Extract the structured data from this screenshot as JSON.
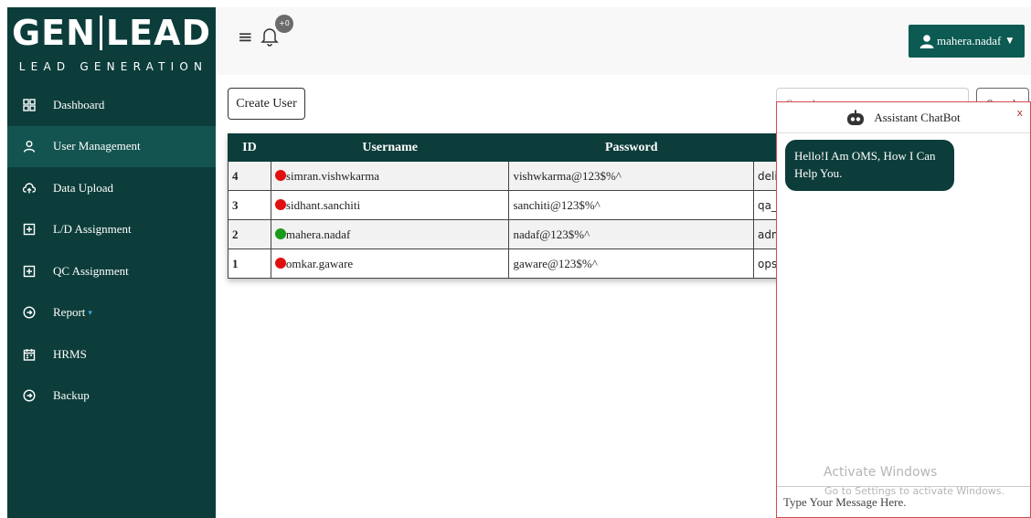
{
  "brand": {
    "name_left": "GEN",
    "name_right": "LEAD",
    "tagline": "LEAD GENERATION"
  },
  "sidebar": {
    "items": [
      {
        "label": "Dashboard",
        "icon": "grid-icon"
      },
      {
        "label": "User Management",
        "icon": "user-icon",
        "active": true
      },
      {
        "label": "Data Upload",
        "icon": "cloud-upload-icon"
      },
      {
        "label": "L/D Assignment",
        "icon": "plus-square-icon"
      },
      {
        "label": "QC Assignment",
        "icon": "plus-square-icon"
      },
      {
        "label": "Report",
        "icon": "circle-arrow-icon",
        "has_dropdown": true
      },
      {
        "label": "HRMS",
        "icon": "calendar-icon"
      },
      {
        "label": "Backup",
        "icon": "circle-arrow-icon"
      }
    ]
  },
  "topbar": {
    "notification_badge": "+0",
    "user_name": "mahera.nadaf"
  },
  "main": {
    "create_user_label": "Create User",
    "search_placeholder": "Search",
    "search_button_label": "Search"
  },
  "users_table": {
    "headers": [
      "ID",
      "Username",
      "Password"
    ],
    "rows": [
      {
        "id": "4",
        "username": "simran.vishwkarma",
        "password": "vishwkarma@123$%^",
        "role": "deli",
        "status_color": "#e01010"
      },
      {
        "id": "3",
        "username": "sidhant.sanchiti",
        "password": "sanchiti@123$%^",
        "role": "qa_c",
        "status_color": "#e01010"
      },
      {
        "id": "2",
        "username": "mahera.nadaf",
        "password": "nadaf@123$%^",
        "role": "adm",
        "status_color": "#1a9a1a"
      },
      {
        "id": "1",
        "username": "omkar.gaware",
        "password": "gaware@123$%^",
        "role": "ops",
        "status_color": "#e01010"
      }
    ]
  },
  "chatbot": {
    "title": "Assistant ChatBot",
    "close_label": "x",
    "bot_message": "Hello!I Am OMS, How I Can Help You.",
    "input_placeholder": "Type Your Message Here."
  },
  "os_watermark": {
    "line1": "Activate Windows",
    "line2": "Go to Settings to activate Windows."
  },
  "colors": {
    "sidebar_bg": "#0c3d3a",
    "sidebar_active": "#145450",
    "accent": "#0c5a52",
    "chat_border": "#d24c4c"
  }
}
